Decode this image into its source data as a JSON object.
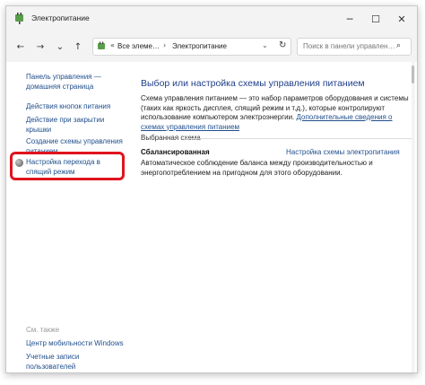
{
  "window": {
    "title": "Электропитание",
    "minimize_glyph": "─",
    "maximize_glyph": "☐",
    "close_glyph": "✕"
  },
  "toolbar": {
    "back_glyph": "←",
    "forward_glyph": "→",
    "recent_glyph": "⌄",
    "up_glyph": "↑",
    "address": {
      "breadcrumb_1": "Все элеме…",
      "breadcrumb_2": "Электропитание",
      "separator": "›",
      "prefix": "«",
      "dropdown_glyph": "⌄",
      "refresh_glyph": "↻"
    },
    "search": {
      "placeholder": "Поиск в панели управлен…",
      "icon_glyph": "⌕"
    }
  },
  "sidebar": {
    "links": [
      {
        "label": "Панель управления — домашняя страница"
      },
      {
        "label": "Действия кнопок питания"
      },
      {
        "label": "Действие при закрытии крышки"
      },
      {
        "label": "Создание схемы управления питанием"
      },
      {
        "label": "Настройка перехода в спящий режим"
      }
    ],
    "see_also_label": "См. также",
    "see_also_links": [
      {
        "label": "Центр мобильности Windows"
      },
      {
        "label": "Учетные записи пользователей"
      }
    ]
  },
  "main": {
    "title": "Выбор или настройка схемы управления питанием",
    "description": "Схема управления питанием — это набор параметров оборудования и системы (таких как яркость дисплея, спящий режим и т.д.), которые контролируют использование компьютером электроэнергии.",
    "description_link": "Дополнительные сведения о схемах управления питанием",
    "selected_plan_label": "Выбранная схема",
    "plan": {
      "name": "Сбалансированная",
      "settings_link": "Настройка схемы электропитания",
      "description": "Автоматическое соблюдение баланса между производительностью и энергопотреблением на пригодном для этого оборудовании."
    }
  },
  "colors": {
    "link": "#1f4e8c",
    "title": "#1f3f8a",
    "highlight": "#e0141e"
  },
  "icons": {
    "app": "power-plug-icon",
    "sleep": "sleep-moon-icon"
  }
}
